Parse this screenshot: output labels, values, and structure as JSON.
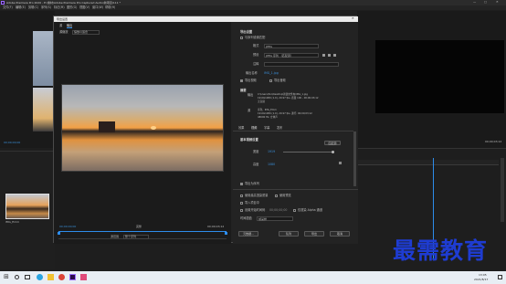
{
  "app": {
    "window_title": "Adobe Premiere Pro 2020 - E:\\素材\\Adobe Premiere Pro Captured Audio\\新项目\\111 *",
    "menu": [
      "文件(F)",
      "编辑(E)",
      "剪辑(C)",
      "序列(S)",
      "标记(M)",
      "图形(G)",
      "视图(V)",
      "窗口(W)",
      "帮助(H)"
    ]
  },
  "left_panel": {
    "timecode": "00;00;00;00",
    "clip_name": "IMG_Emm",
    "track_time": "00;00;00;00"
  },
  "dialog": {
    "title": "导出设置",
    "tabs": [
      "源",
      "输出"
    ],
    "source_scaling_label": "源缩放",
    "source_scaling_value": "缩放以适合",
    "timecode_in": "00;00;00;00",
    "timecode_out": "00;00;03;12",
    "range_label": "源范围",
    "range_value": "整个序列",
    "export_settings": {
      "header": "导出设置",
      "match_sequence_label": "与序列设置匹配",
      "format_label": "格式",
      "format_value": "JPEG",
      "preset_label": "预设",
      "preset_value": "JPEG 序列 （匹配源）",
      "comment_label": "注释",
      "output_name_label": "输出名称",
      "output_name_value": "IMG_1.jpg",
      "export_video_label": "导出视频",
      "export_audio_label": "导出音频",
      "summary_label": "摘要",
      "output_info_label": "输出",
      "output_info_line1": "C:\\Users\\foo\\Desktop\\新建文件夹\\IMG_1.jpg",
      "output_info_line2": "1919x1080 (1.0), 29.97 fps, 质量 100 - 00;00;03;12",
      "output_info_line3": "无音频",
      "source_info_label": "源",
      "source_info_line1": "序列，IMG_Emm",
      "source_info_line2": "1919x1080 (1.0), 29.97 fps, 逐行, 00;00;03;12",
      "source_info_line3": "48000 Hz, 立体声"
    },
    "settings_tabs": [
      "效果",
      "视频",
      "字幕",
      "发布"
    ],
    "basic_video": {
      "header": "基本视频设置",
      "match_source_button": "匹配源",
      "width_label": "宽度",
      "width_value": "1919",
      "height_label": "高度",
      "height_value": "1080",
      "export_as_sequence_label": "导出为序列"
    },
    "options": {
      "max_render_quality_label": "使用最高渲染质量",
      "use_previews_label": "使用预览",
      "import_into_project_label": "导入项目中",
      "set_start_timecode_label": "设置开始时间码",
      "start_timecode_value": "00;00;00;00",
      "render_alpha_label": "仅渲染 Alpha 通道",
      "time_interpolation_label": "时间插值",
      "time_interpolation_value": "帧采样"
    },
    "buttons": {
      "metadata": "元数据...",
      "queue": "队列",
      "export": "导出",
      "cancel": "取消"
    }
  },
  "program_monitor": {
    "timecode": "00;00;03;12",
    "fit_label": "完整"
  },
  "timeline": {
    "ruler": [
      "00;00",
      "00;00;00;00",
      "00;00;01;00",
      "00;00;02;00",
      "00;00;03;00",
      "00;00;04;00"
    ]
  },
  "watermark": "最需教育",
  "taskbar": {
    "time": "13:05",
    "date": "2021/8/17"
  },
  "colors": {
    "accent": "#2d8ceb",
    "dialog_bg": "#232323",
    "panel_bg": "#1e1e1e",
    "watermark": "#1e3cd2"
  }
}
